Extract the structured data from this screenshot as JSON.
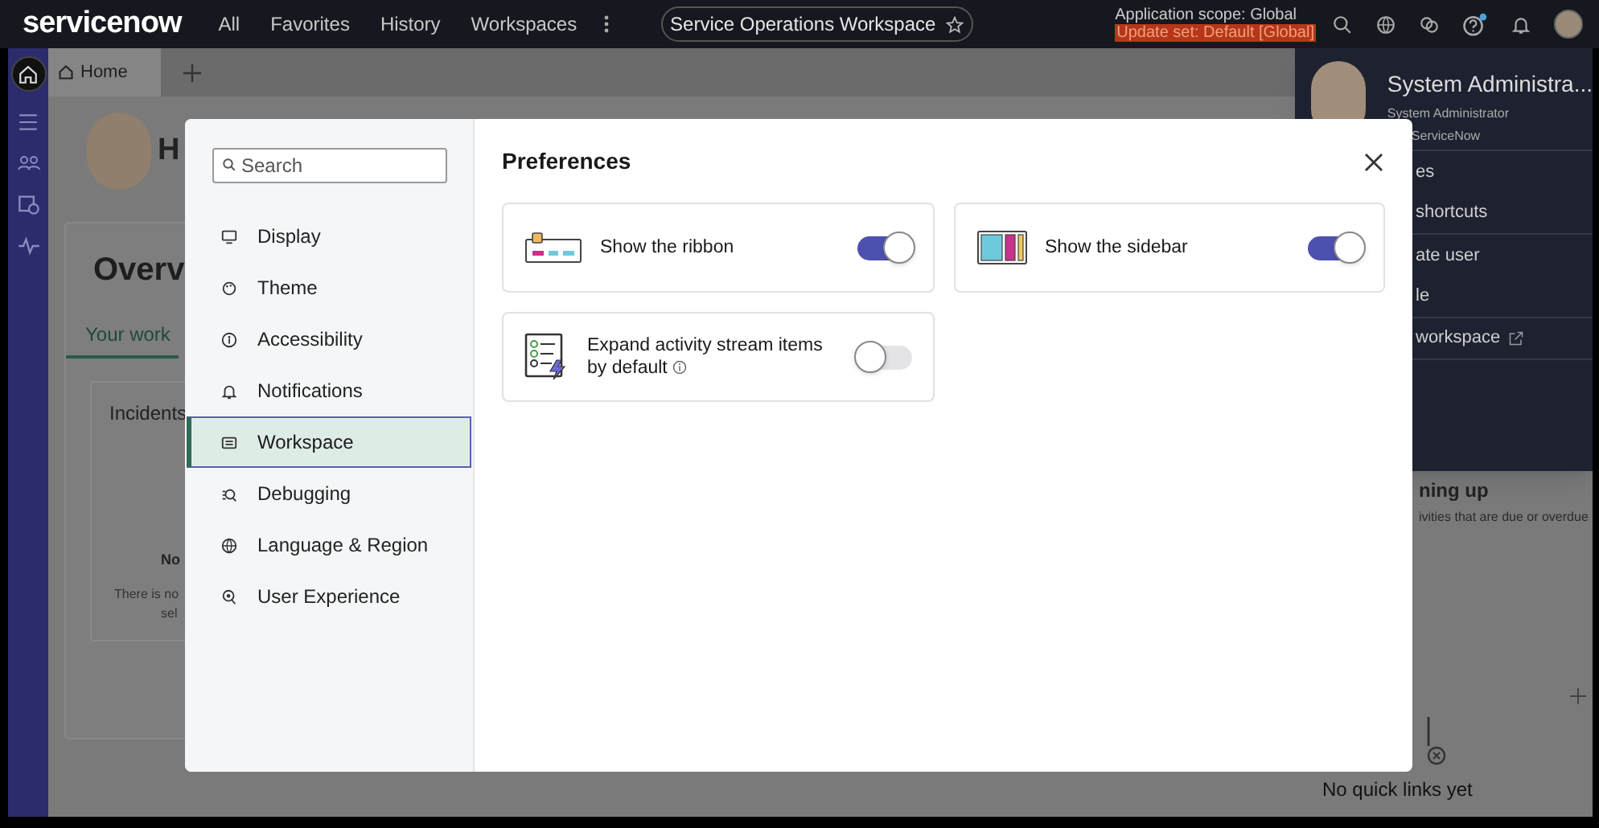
{
  "header": {
    "logo": "servicenow",
    "nav": [
      "All",
      "Favorites",
      "History",
      "Workspaces"
    ],
    "workspace_pill": "Service Operations Workspace",
    "scope": "Application scope: Global",
    "update_set": "Update set: Default [Global]"
  },
  "tabs": [
    {
      "label": "Home",
      "selected": true
    }
  ],
  "background": {
    "greeting": "H",
    "heading": "Overv",
    "tab": "Your work",
    "card_title": "Incidents",
    "empty_title": "No",
    "empty_text_1": "There is no",
    "empty_text_2": "sel",
    "right_title": "ning up",
    "right_text": "ivities that are due or overdue",
    "quick_links_empty": "No quick links yet"
  },
  "profile_menu": {
    "name": "System Administra...",
    "role": "System Administrator",
    "company": "ServiceNow",
    "items": [
      {
        "label": "es",
        "external": false
      },
      {
        "label": "shortcuts",
        "external": false
      },
      {
        "label": "ate user",
        "external": false
      },
      {
        "label": "le",
        "external": false
      },
      {
        "label": "workspace",
        "external": true
      }
    ]
  },
  "modal": {
    "search_placeholder": "Search",
    "title": "Preferences",
    "nav": [
      {
        "label": "Display",
        "kind": "display",
        "selected": false
      },
      {
        "label": "Theme",
        "kind": "theme",
        "selected": false
      },
      {
        "label": "Accessibility",
        "kind": "accessibility",
        "selected": false
      },
      {
        "label": "Notifications",
        "kind": "notifications",
        "selected": false
      },
      {
        "label": "Workspace",
        "kind": "workspace",
        "selected": true
      },
      {
        "label": "Debugging",
        "kind": "debugging",
        "selected": false
      },
      {
        "label": "Language & Region",
        "kind": "language",
        "selected": false
      },
      {
        "label": "User Experience",
        "kind": "user_experience",
        "selected": false
      }
    ],
    "settings": [
      {
        "label": "Show the ribbon",
        "kind": "ribbon",
        "on": true,
        "info": false
      },
      {
        "label": "Show the sidebar",
        "kind": "sidebar",
        "on": true,
        "info": false
      },
      {
        "label": "Expand activity stream items by default",
        "kind": "activity",
        "on": false,
        "info": true
      }
    ]
  }
}
